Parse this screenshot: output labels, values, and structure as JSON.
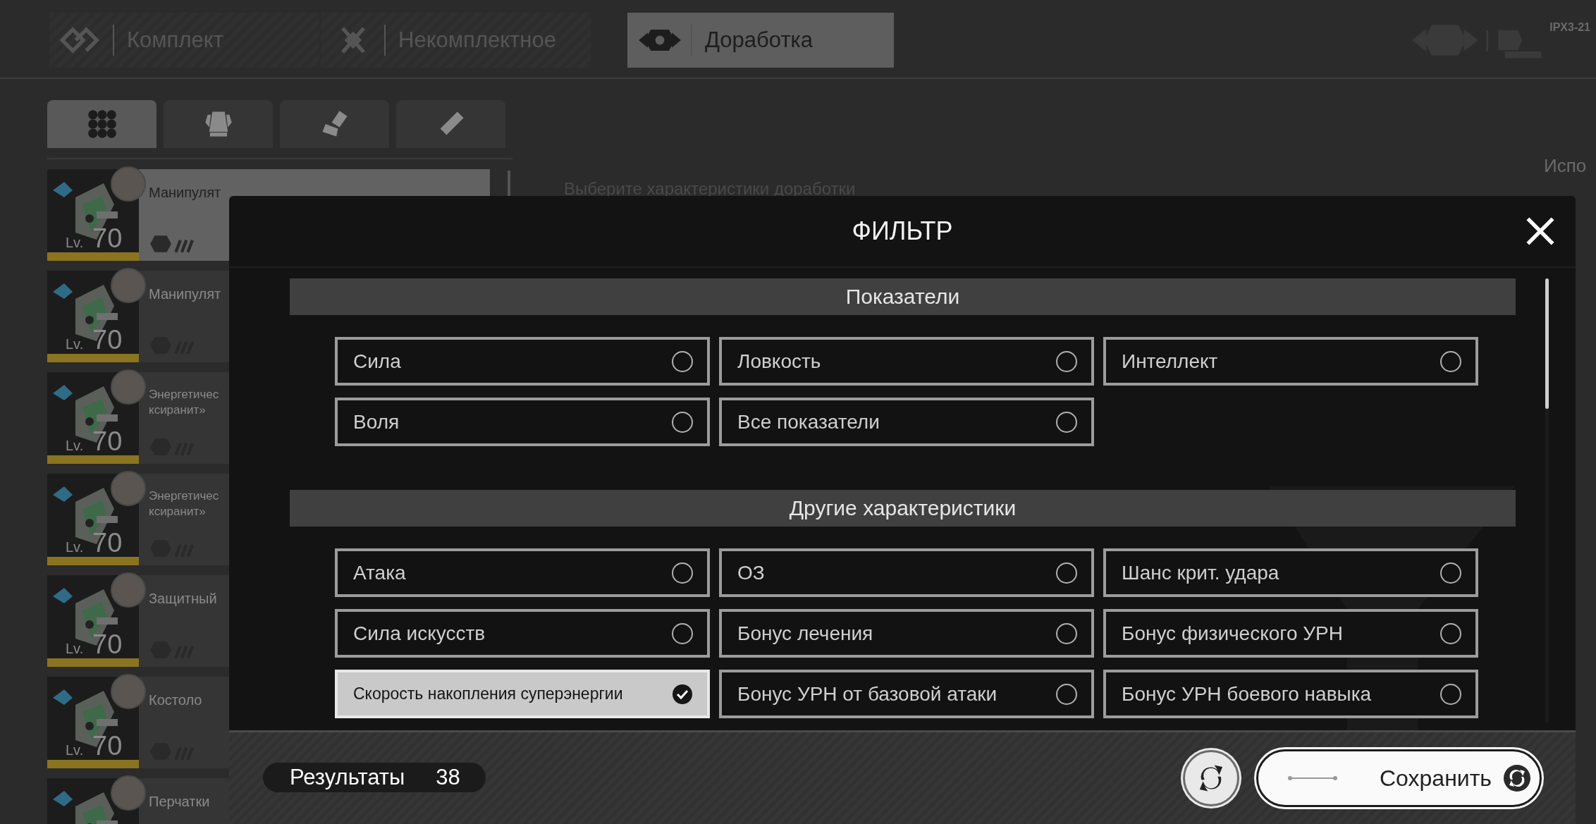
{
  "mode_tabs": [
    {
      "label": "Комплект",
      "selected": false,
      "kind": "diamond"
    },
    {
      "label": "Некомплектное",
      "selected": false,
      "kind": "cross"
    },
    {
      "label": "Доработка",
      "selected": true,
      "kind": "hex"
    }
  ],
  "badge_text": "IPX3-21",
  "category_tabs": [
    {
      "kind": "grid",
      "selected": true
    },
    {
      "kind": "armor",
      "selected": false
    },
    {
      "kind": "glove",
      "selected": false
    },
    {
      "kind": "kit",
      "selected": false
    }
  ],
  "equipment_list": [
    {
      "name_lines": [
        "Манипулят"
      ],
      "lv_label": "Lv.",
      "lv_value": "70",
      "selected": true
    },
    {
      "name_lines": [
        "Манипулят"
      ],
      "lv_label": "Lv.",
      "lv_value": "70",
      "selected": false
    },
    {
      "name_lines": [
        "Энергетичес",
        "ксиранит»"
      ],
      "lv_label": "Lv.",
      "lv_value": "70",
      "selected": false
    },
    {
      "name_lines": [
        "Энергетичес",
        "ксиранит»"
      ],
      "lv_label": "Lv.",
      "lv_value": "70",
      "selected": false
    },
    {
      "name_lines": [
        "Защитный"
      ],
      "lv_label": "Lv.",
      "lv_value": "70",
      "selected": false
    },
    {
      "name_lines": [
        "Костоло"
      ],
      "lv_label": "Lv.",
      "lv_value": "70",
      "selected": false
    },
    {
      "name_lines": [
        "Перчатки"
      ],
      "selected": false
    }
  ],
  "hint": "Выберите характеристики доработки",
  "side_label": "Испо",
  "filter": {
    "title": "ФИЛЬТР",
    "sections": [
      {
        "title": "Показатели",
        "options": [
          {
            "label": "Сила",
            "selected": false
          },
          {
            "label": "Ловкость",
            "selected": false
          },
          {
            "label": "Интеллект",
            "selected": false
          },
          {
            "label": "Воля",
            "selected": false
          },
          {
            "label": "Все показатели",
            "selected": false
          }
        ]
      },
      {
        "title": "Другие характеристики",
        "options": [
          {
            "label": "Атака",
            "selected": false
          },
          {
            "label": "ОЗ",
            "selected": false
          },
          {
            "label": "Шанс крит. удара",
            "selected": false
          },
          {
            "label": "Сила искусств",
            "selected": false
          },
          {
            "label": "Бонус лечения",
            "selected": false
          },
          {
            "label": "Бонус физического УРН",
            "selected": false
          },
          {
            "label": "Скорость накопления суперэнергии",
            "selected": true
          },
          {
            "label": "Бонус УРН от базовой атаки",
            "selected": false
          },
          {
            "label": "Бонус УРН боевого навыка",
            "selected": false
          }
        ]
      }
    ],
    "results_label": "Результаты",
    "results_count": "38",
    "save_label": "Сохранить"
  }
}
